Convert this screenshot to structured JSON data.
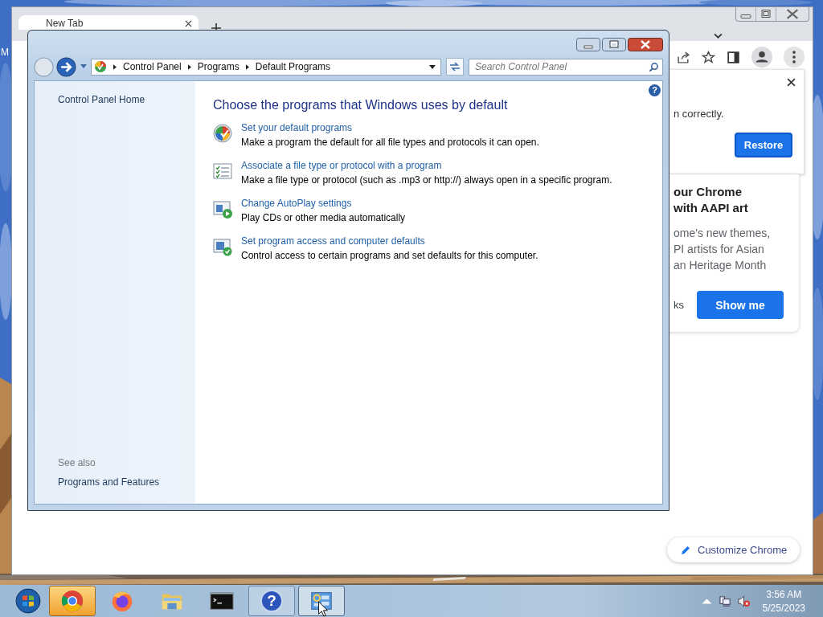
{
  "desktop": {
    "icon_label": "M"
  },
  "browser": {
    "tab": {
      "title": "New Tab"
    },
    "restore_popup": {
      "message": "n correctly.",
      "button": "Restore"
    },
    "promo_card": {
      "title_lines": [
        "our Chrome",
        "with AAPI art"
      ],
      "body_lines": [
        "ome's new themes,",
        "PI artists for Asian",
        "an Heritage Month"
      ],
      "link": "ks",
      "button": "Show me"
    },
    "customize_button": "Customize Chrome"
  },
  "control_panel": {
    "breadcrumb": [
      "Control Panel",
      "Programs",
      "Default Programs"
    ],
    "search": {
      "placeholder": "Search Control Panel"
    },
    "help_glyph": "?",
    "sidebar": {
      "home": "Control Panel Home",
      "see_also_heading": "See also",
      "see_also": [
        "Programs and Features"
      ]
    },
    "heading": "Choose the programs that Windows uses by default",
    "tasks": [
      {
        "kind": "defaults",
        "link": "Set your default programs",
        "description": "Make a program the default for all file types and protocols it can open."
      },
      {
        "kind": "associate",
        "link": "Associate a file type or protocol with a program",
        "description": "Make a file type or protocol (such as .mp3 or http://) always open in a specific program."
      },
      {
        "kind": "autoplay",
        "link": "Change AutoPlay settings",
        "description": "Play CDs or other media automatically"
      },
      {
        "kind": "access",
        "link": "Set program access and computer defaults",
        "description": "Control access to certain programs and set defaults for this computer."
      }
    ]
  },
  "taskbar": {
    "apps": [
      {
        "kind": "chrome",
        "open": false,
        "attention": true,
        "selected": false
      },
      {
        "kind": "firefox",
        "open": false,
        "attention": false,
        "selected": false
      },
      {
        "kind": "explorer",
        "open": false,
        "attention": false,
        "selected": false
      },
      {
        "kind": "cmd",
        "open": false,
        "attention": false,
        "selected": false
      },
      {
        "kind": "help",
        "open": true,
        "attention": false,
        "selected": false,
        "glyph": "?"
      },
      {
        "kind": "control-panel",
        "open": true,
        "attention": false,
        "selected": true
      }
    ],
    "clock": {
      "time": "3:56 AM",
      "date": "5/25/2023"
    }
  }
}
